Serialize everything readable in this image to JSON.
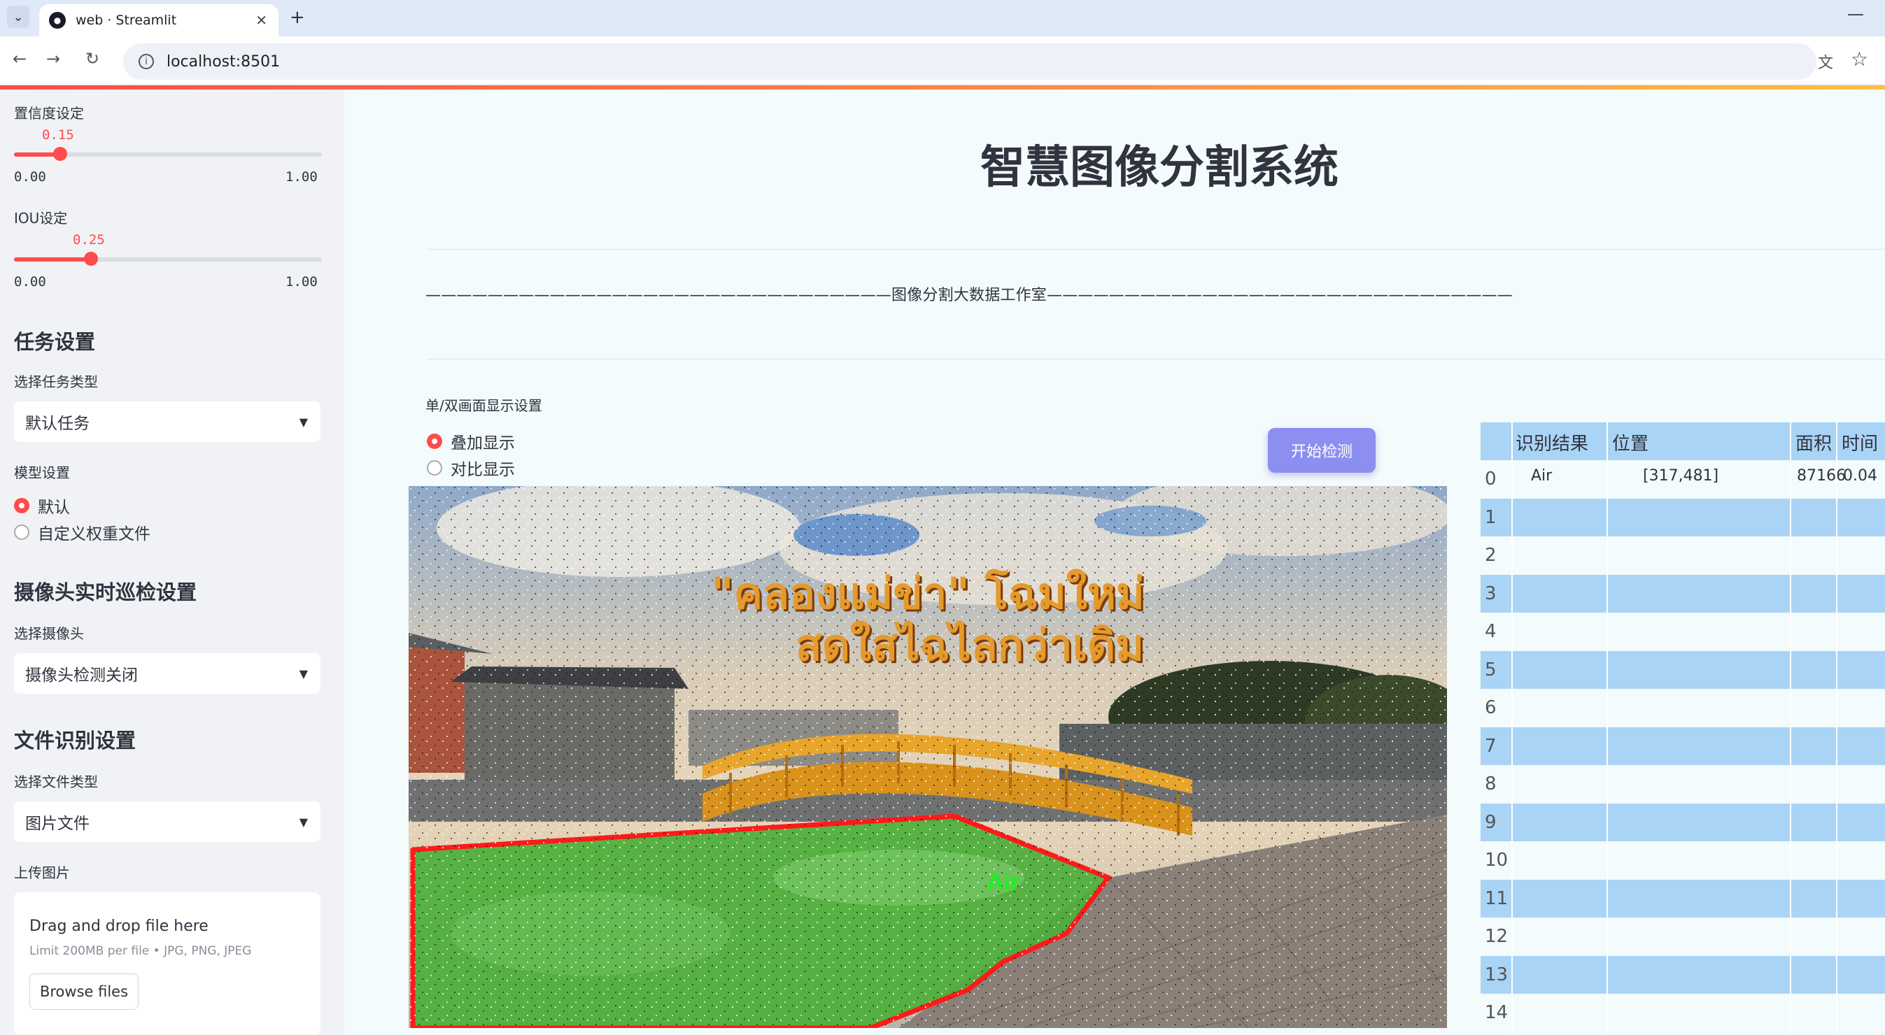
{
  "browser": {
    "tab_title": "web · Streamlit",
    "url": "localhost:8501"
  },
  "sidebar": {
    "confidence": {
      "label": "置信度设定",
      "value": "0.15",
      "fraction": 0.15,
      "min": "0.00",
      "max": "1.00"
    },
    "iou": {
      "label": "IOU设定",
      "value": "0.25",
      "fraction": 0.25,
      "min": "0.00",
      "max": "1.00"
    },
    "task": {
      "title": "任务设置",
      "select_label": "选择任务类型",
      "selected": "默认任务"
    },
    "model": {
      "label": "模型设置",
      "options": [
        "默认",
        "自定义权重文件"
      ],
      "selected_index": 0
    },
    "camera": {
      "title": "摄像头实时巡检设置",
      "select_label": "选择摄像头",
      "selected": "摄像头检测关闭"
    },
    "file": {
      "title": "文件识别设置",
      "select_label": "选择文件类型",
      "selected": "图片文件",
      "upload_label": "上传图片"
    },
    "uploader": {
      "title": "Drag and drop file here",
      "limit": "Limit 200MB per file • JPG, PNG, JPEG",
      "button": "Browse files"
    }
  },
  "main": {
    "title": "智慧图像分割系统",
    "banner": "——————————————————————————————图像分割大数据工作室——————————————————————————————",
    "display_label": "单/双画面显示设置",
    "display_options": [
      "叠加显示",
      "对比显示"
    ],
    "display_selected_index": 0,
    "start_button": "开始检测",
    "image": {
      "overlay_text_line1": "\"คลองแม่ข่า\" โฉมใหม่",
      "overlay_text_line2": "สดใสไฉไลกว่าเดิม",
      "detection_label": "Air",
      "colors": {
        "mask": "#4caf3a",
        "outline": "#ff1a1a",
        "label": "#22ee22"
      }
    }
  },
  "table": {
    "headers": [
      "识别结果",
      "位置",
      "面积",
      "时间"
    ],
    "rows": [
      {
        "idx": "0",
        "result": "Air",
        "position": "[317,481]",
        "area": "87166",
        "time": "0.04"
      },
      {
        "idx": "1"
      },
      {
        "idx": "2"
      },
      {
        "idx": "3"
      },
      {
        "idx": "4"
      },
      {
        "idx": "5"
      },
      {
        "idx": "6"
      },
      {
        "idx": "7"
      },
      {
        "idx": "8"
      },
      {
        "idx": "9"
      },
      {
        "idx": "10"
      },
      {
        "idx": "11"
      },
      {
        "idx": "12"
      },
      {
        "idx": "13"
      },
      {
        "idx": "14"
      }
    ]
  }
}
